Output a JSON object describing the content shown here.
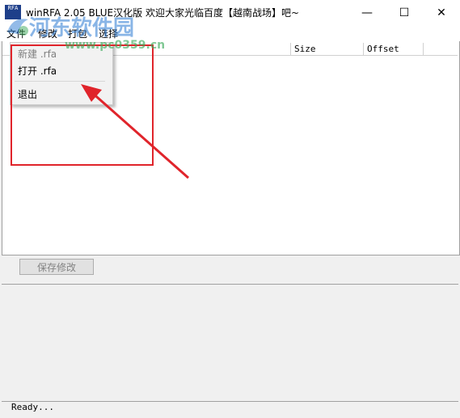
{
  "window": {
    "title": "winRFA 2.05 BLUE汉化版 欢迎大家光临百度【越南战场】吧~",
    "icon_text": "RFA",
    "controls": {
      "minimize": "—",
      "maximize": "☐",
      "close": "✕"
    }
  },
  "menubar": {
    "items": [
      {
        "label": "文件"
      },
      {
        "label": "修改"
      },
      {
        "label": "打包"
      },
      {
        "label": "选择"
      }
    ]
  },
  "dropdown": {
    "items": [
      {
        "label": "新建 .rfa"
      },
      {
        "label": "打开 .rfa"
      },
      {
        "label": "退出"
      }
    ]
  },
  "list": {
    "columns": [
      "",
      "Size",
      "Offset",
      ""
    ]
  },
  "save_button": {
    "label": "保存修改"
  },
  "status": {
    "text": "Ready..."
  },
  "watermark": {
    "text": "河东软件园",
    "url": "www.pc0359.cn"
  },
  "colors": {
    "annotation": "#e0242b",
    "title_icon": "#1e3f8a"
  }
}
